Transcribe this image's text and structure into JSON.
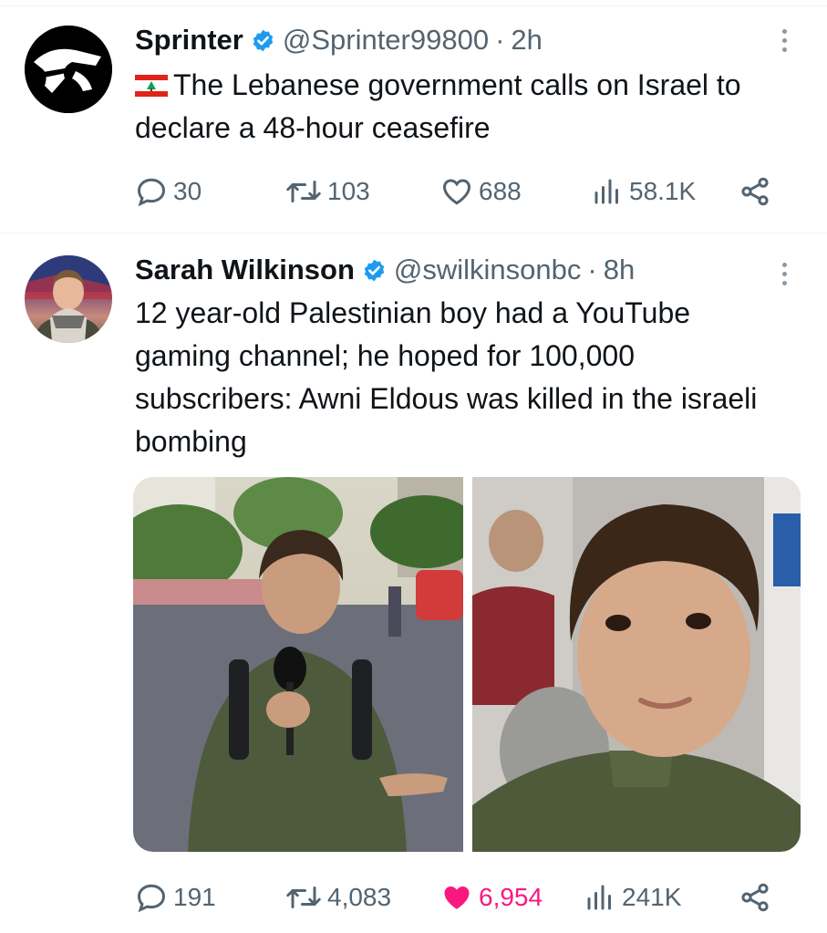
{
  "tweets": [
    {
      "name": "Sprinter",
      "handle": "@Sprinter99800",
      "separator": "·",
      "time": "2h",
      "text": "The Lebanese government calls on Israel to declare a 48-hour ceasefire",
      "flag_icon": "lebanon-flag-icon",
      "stats": {
        "replies": "30",
        "reposts": "103",
        "likes": "688",
        "views": "58.1K"
      },
      "liked": false
    },
    {
      "name": "Sarah Wilkinson",
      "handle": "@swilkinsonbc",
      "separator": "·",
      "time": "8h",
      "text": "12 year-old Palestinian boy had a YouTube gaming channel; he hoped for 100,000 subscribers: Awni Eldous was killed in the israeli bombing",
      "stats": {
        "replies": "191",
        "reposts": "4,083",
        "likes": "6,954",
        "views": "241K"
      },
      "liked": true
    }
  ],
  "colors": {
    "accent": "#1d9bf0",
    "muted": "#536471",
    "like": "#f91880",
    "text": "#0f1419"
  },
  "icons": [
    "verified-badge-icon",
    "more-icon",
    "reply-icon",
    "repost-icon",
    "like-icon",
    "views-icon",
    "share-icon"
  ]
}
